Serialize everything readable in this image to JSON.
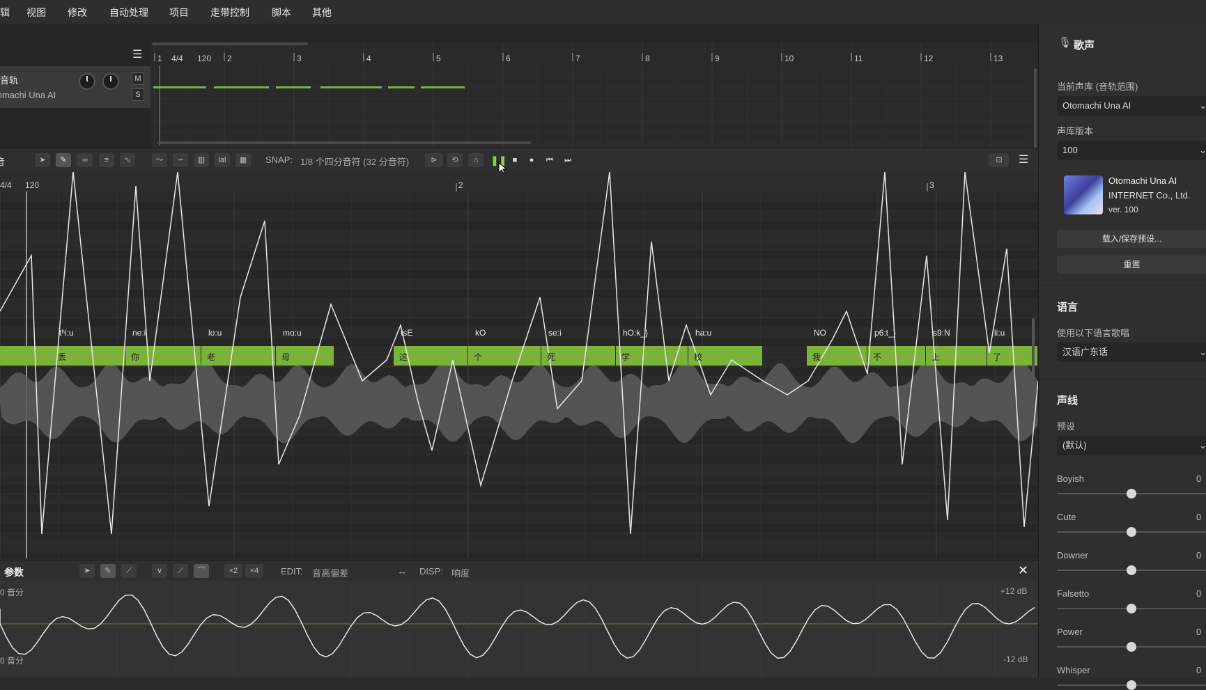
{
  "menu": {
    "items": [
      "编辑",
      "视图",
      "修改",
      "自动处理",
      "项目",
      "走带控制",
      "脚本",
      "其他"
    ]
  },
  "arrangement": {
    "time_signature": "4/4",
    "tempo": "120",
    "bar_numbers": [
      "1",
      "2",
      "3",
      "4",
      "5",
      "6",
      "7",
      "8",
      "9",
      "10",
      "11",
      "12",
      "13"
    ],
    "track": {
      "name": "音轨",
      "voice": "Otomachi Una AI",
      "mute_label": "M",
      "solo_label": "S"
    }
  },
  "toolbar": {
    "snap_label": "SNAP:",
    "snap_value": "1/8 个四分音符 (32 分音符)",
    "pianoroll_title": "音",
    "playing_state": "playing"
  },
  "pianoroll": {
    "time_signature": "4/4",
    "tempo": "120",
    "bar_numbers": [
      "2",
      "3"
    ],
    "notes": [
      {
        "lyric": "丢",
        "phonemes": "tʰi:u"
      },
      {
        "lyric": "你",
        "phonemes": "ne:i"
      },
      {
        "lyric": "老",
        "phonemes": "lo:u"
      },
      {
        "lyric": "母",
        "phonemes": "mo:u"
      },
      {
        "lyric": "这",
        "phonemes": "tsE"
      },
      {
        "lyric": "个",
        "phonemes": "kO"
      },
      {
        "lyric": "死",
        "phonemes": "se:i"
      },
      {
        "lyric": "学",
        "phonemes": "hO:k_}"
      },
      {
        "lyric": "校",
        "phonemes": "ha:u"
      },
      {
        "lyric": "我",
        "phonemes": "NO"
      },
      {
        "lyric": "不",
        "phonemes": "p6:t_}"
      },
      {
        "lyric": "上",
        "phonemes": "s9:N"
      },
      {
        "lyric": "了",
        "phonemes": "li:u"
      }
    ],
    "note_color": "#7bb33a"
  },
  "params": {
    "title": "参数",
    "x2": "×2",
    "x4": "×4",
    "edit_label": "EDIT:",
    "edit_value": "音高偏差",
    "disp_label": "DISP:",
    "disp_value": "响度",
    "top_left": "0 音分",
    "bottom_left": "0 音分",
    "top_right": "+12 dB",
    "bottom_right": "-12 dB"
  },
  "right_panel": {
    "section_voice": "歌声",
    "current_voicebank_label": "当前声库 (音轨范围)",
    "current_voicebank": "Otomachi Una AI",
    "version_label": "声库版本",
    "version_value": "100",
    "voice_name": "Otomachi Una AI",
    "voice_company": "INTERNET Co., Ltd.",
    "voice_version": "ver. 100",
    "load_save_button": "载入/保存预设...",
    "reset_button": "重置",
    "section_language": "语言",
    "language_prompt": "使用以下语言歌唱",
    "language_value": "汉语广东话",
    "section_voice_line": "声线",
    "preset_label": "预设",
    "preset_value": "(默认)",
    "sliders": [
      {
        "label": "Boyish",
        "value": "0"
      },
      {
        "label": "Cute",
        "value": "0"
      },
      {
        "label": "Downer",
        "value": "0"
      },
      {
        "label": "Falsetto",
        "value": "0"
      },
      {
        "label": "Power",
        "value": "0"
      },
      {
        "label": "Whisper",
        "value": "0"
      }
    ]
  }
}
